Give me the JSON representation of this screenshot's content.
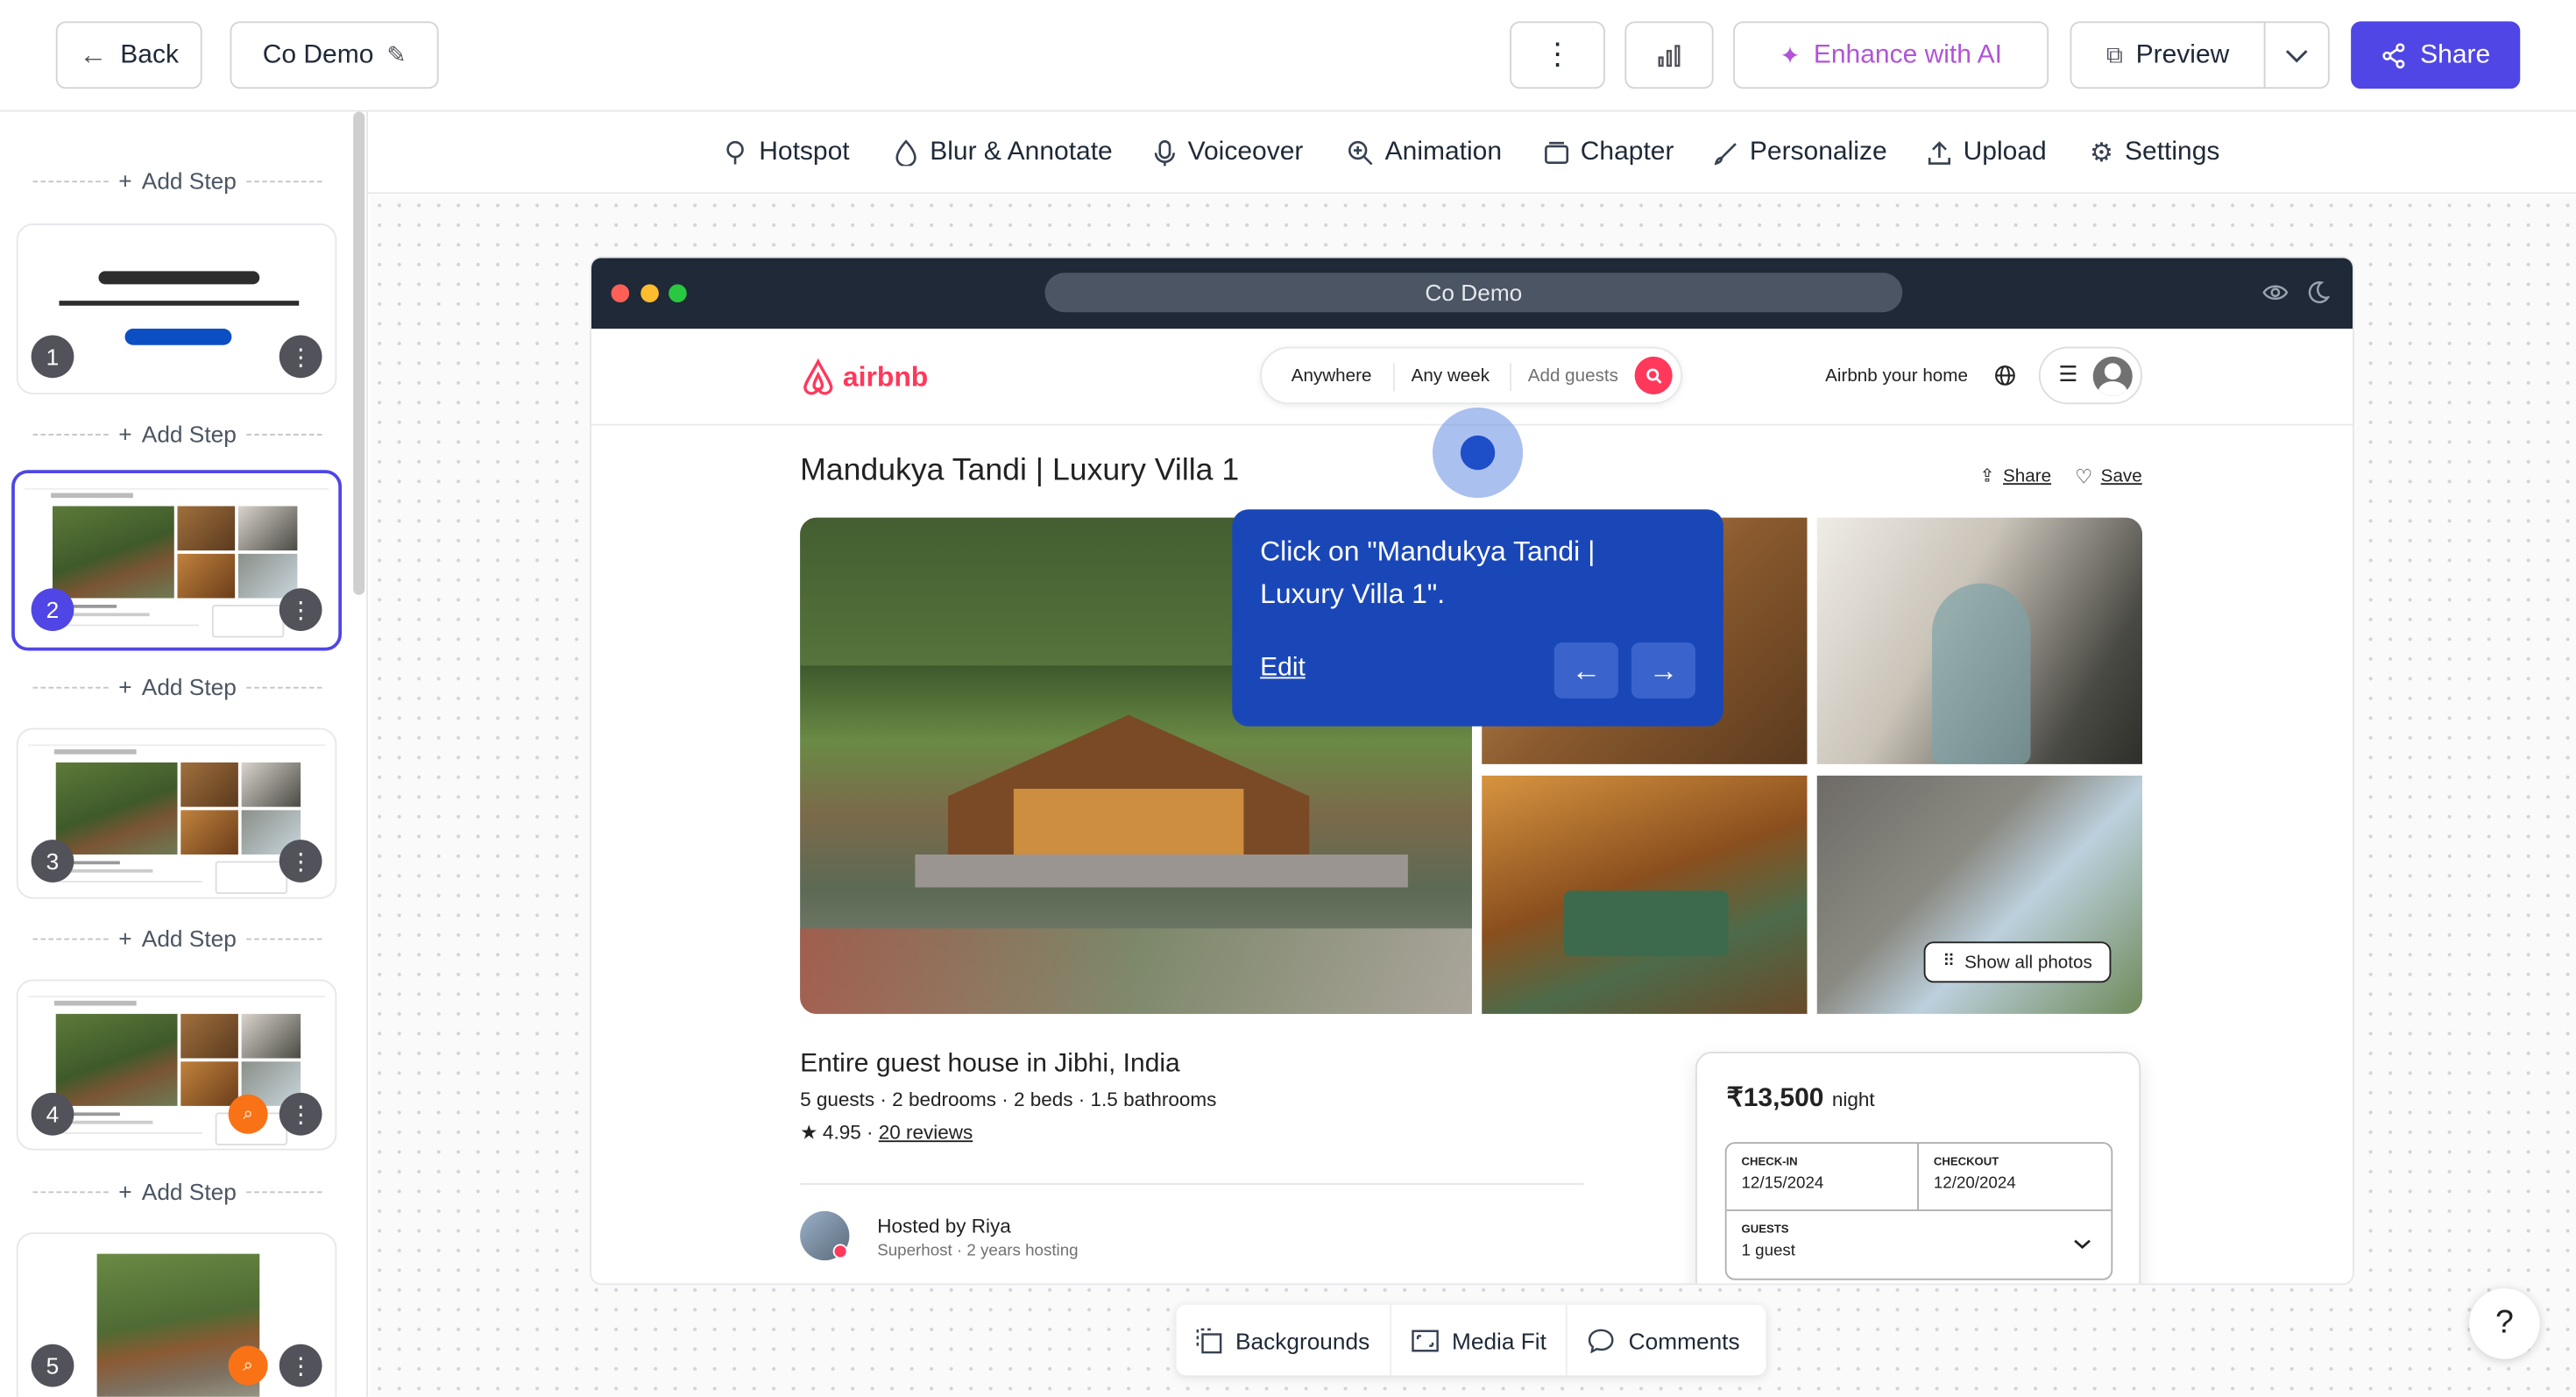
{
  "topbar": {
    "back_label": "Back",
    "demo_title": "Co Demo",
    "enhance_label": "Enhance with AI",
    "preview_label": "Preview",
    "share_label": "Share"
  },
  "toolbar": {
    "items": [
      {
        "label": "Hotspot",
        "icon": "hotspot-icon"
      },
      {
        "label": "Blur & Annotate",
        "icon": "blur-icon"
      },
      {
        "label": "Voiceover",
        "icon": "microphone-icon"
      },
      {
        "label": "Animation",
        "icon": "zoom-icon"
      },
      {
        "label": "Chapter",
        "icon": "chapter-icon"
      },
      {
        "label": "Personalize",
        "icon": "brush-icon"
      },
      {
        "label": "Upload",
        "icon": "upload-icon"
      },
      {
        "label": "Settings",
        "icon": "gear-icon"
      }
    ]
  },
  "sidebar": {
    "add_step_label": "Add Step",
    "steps": [
      {
        "number": "1"
      },
      {
        "number": "2",
        "selected": true
      },
      {
        "number": "3"
      },
      {
        "number": "4"
      },
      {
        "number": "5"
      }
    ]
  },
  "browser": {
    "url_title": "Co Demo"
  },
  "airbnb": {
    "logo_text": "airbnb",
    "search": {
      "anywhere": "Anywhere",
      "any_week": "Any week",
      "add_guests": "Add guests"
    },
    "host_link": "Airbnb your home",
    "listing_title": "Mandukya Tandi | Luxury Villa 1",
    "share_label": "Share",
    "save_label": "Save",
    "show_all_photos": "Show all photos",
    "subtitle": "Entire guest house in Jibhi, India",
    "details": "5 guests · 2 bedrooms · 2 beds · 1.5 bathrooms",
    "rating": "4.95",
    "rating_sep": " · ",
    "reviews_link": "20 reviews",
    "host_name": "Hosted by Riya",
    "host_meta": "Superhost · 2 years hosting",
    "booking": {
      "price": "₹13,500",
      "per": "night",
      "checkin_label": "CHECK-IN",
      "checkin_value": "12/15/2024",
      "checkout_label": "CHECKOUT",
      "checkout_value": "12/20/2024",
      "guests_label": "GUESTS",
      "guests_value": "1 guest"
    }
  },
  "tooltip": {
    "text": "Click on \"Mandukya Tandi | Luxury Villa 1\".",
    "edit_label": "Edit"
  },
  "bottombar": {
    "backgrounds": "Backgrounds",
    "media_fit": "Media Fit",
    "comments": "Comments"
  },
  "help_label": "?",
  "colors": {
    "accent": "#4f46e5",
    "tooltip": "#1a47b8",
    "airbnb": "#ff385c",
    "enhance": "#b154d6"
  }
}
